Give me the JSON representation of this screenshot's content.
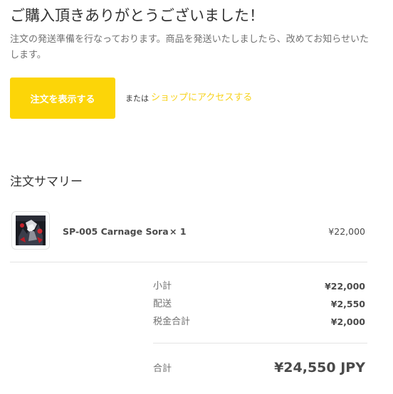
{
  "confirmation": {
    "title": "ご購入頂きありがとうございました！",
    "message": "注文の発送準備を行なっております。商品を発送いたしましたら、改めてお知らせいたします。",
    "view_order_button": "注文を表示する",
    "or_text": "または",
    "shop_link": "ショップにアクセスする"
  },
  "summary": {
    "heading": "注文サマリー",
    "item": {
      "name": "SP-005 Carnage Sora",
      "quantity": "× 1",
      "price": "¥22,000",
      "thumbnail_icon": "product-image"
    },
    "lines": {
      "subtotal_label": "小計",
      "subtotal_value": "¥22,000",
      "shipping_label": "配送",
      "shipping_value": "¥2,550",
      "tax_label": "税金合計",
      "tax_value": "¥2,000",
      "total_label": "合計",
      "total_value": "¥24,550 JPY"
    }
  },
  "colors": {
    "accent": "#fcd508",
    "link": "#f7d21c",
    "text": "#333333",
    "muted": "#707070"
  }
}
